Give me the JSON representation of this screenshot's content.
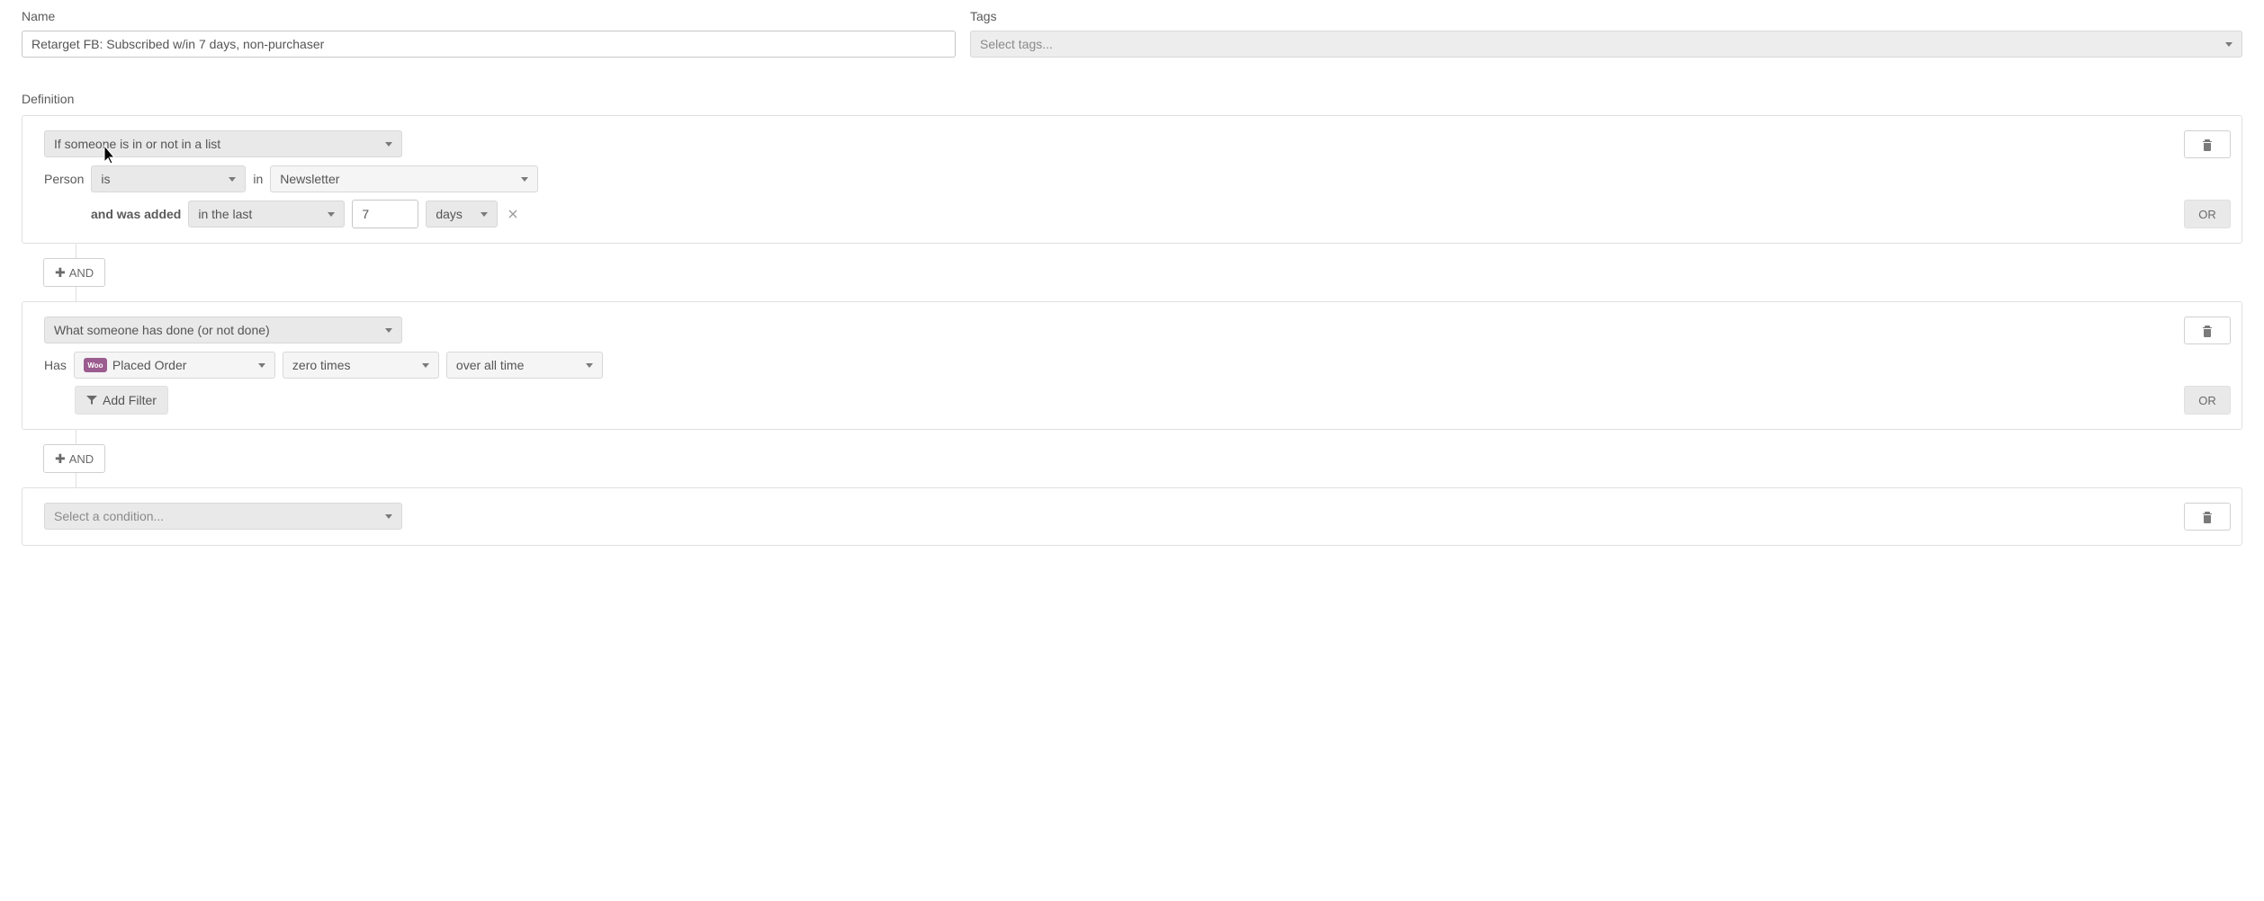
{
  "form": {
    "name_label": "Name",
    "name_value": "Retarget FB: Subscribed w/in 7 days, non-purchaser",
    "tags_label": "Tags",
    "tags_placeholder": "Select tags..."
  },
  "definition_label": "Definition",
  "and_label": "AND",
  "or_label": "OR",
  "add_filter_label": "Add Filter",
  "woo_badge": "Woo",
  "blocks": [
    {
      "type": "If someone is in or not in a list",
      "person_label": "Person",
      "op": "is",
      "in_label": "in",
      "list": "Newsletter",
      "added_label": "and was added",
      "range": "in the last",
      "qty": "7",
      "unit": "days"
    },
    {
      "type": "What someone has done (or not done)",
      "has_label": "Has",
      "event": "Placed Order",
      "freq": "zero times",
      "time": "over all time"
    },
    {
      "type_placeholder": "Select a condition..."
    }
  ]
}
